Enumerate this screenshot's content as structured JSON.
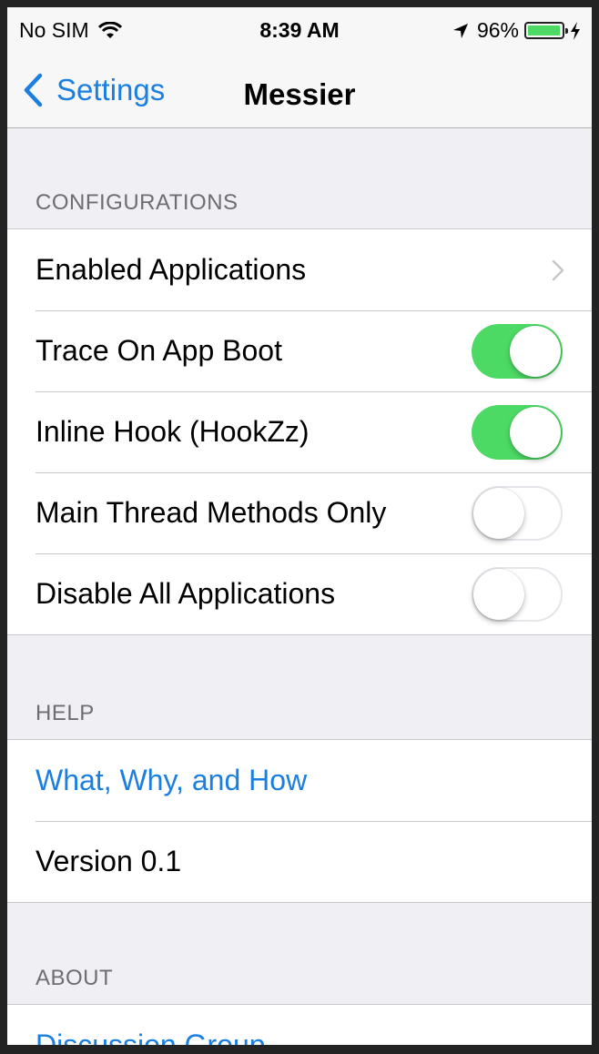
{
  "status_bar": {
    "carrier": "No SIM",
    "time": "8:39 AM",
    "battery_percent": "96%",
    "battery_level": 0.96,
    "battery_color": "#4cd964"
  },
  "nav": {
    "back_label": "Settings",
    "title": "Messier"
  },
  "sections": {
    "configurations": {
      "header": "CONFIGURATIONS",
      "rows": [
        {
          "label": "Enabled Applications",
          "accessory": "chevron-right-icon"
        },
        {
          "label": "Trace On App Boot",
          "toggle": true
        },
        {
          "label": "Inline Hook (HookZz)",
          "toggle": true
        },
        {
          "label": "Main Thread Methods Only",
          "toggle": false
        },
        {
          "label": "Disable All Applications",
          "toggle": false
        }
      ]
    },
    "help": {
      "header": "HELP",
      "rows": [
        {
          "label": "What, Why, and How",
          "link": true
        },
        {
          "label": "Version 0.1"
        }
      ]
    },
    "about": {
      "header": "ABOUT",
      "rows": [
        {
          "label": "Discussion Group",
          "link": true
        }
      ]
    }
  },
  "colors": {
    "accent": "#1a7fe0",
    "toggle_on": "#4cd964",
    "background": "#efeff4"
  }
}
